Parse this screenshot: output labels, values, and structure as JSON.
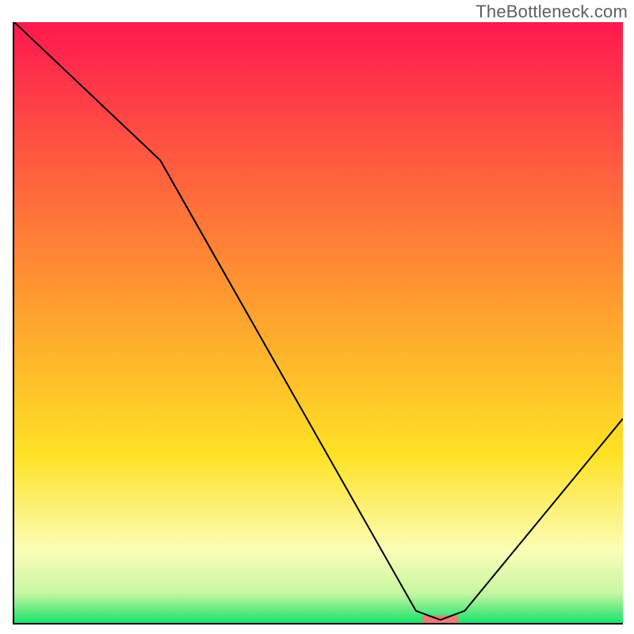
{
  "watermark": "TheBottleneck.com",
  "chart_data": {
    "type": "line",
    "title": "",
    "xlabel": "",
    "ylabel": "",
    "xlim": [
      0,
      100
    ],
    "ylim": [
      0,
      100
    ],
    "x": [
      0,
      24,
      66,
      70,
      74,
      100
    ],
    "values": [
      100,
      77,
      2,
      0.5,
      2,
      34
    ],
    "marker": {
      "x_range": [
        67,
        73
      ],
      "y": 0.5,
      "color": "#eb7c7b"
    },
    "gradient_stops": [
      {
        "pos": 0,
        "color": "#ff1950"
      },
      {
        "pos": 45,
        "color": "#ff9830"
      },
      {
        "pos": 72,
        "color": "#ffe225"
      },
      {
        "pos": 88,
        "color": "#fbfdb7"
      },
      {
        "pos": 95,
        "color": "#c8f7a2"
      },
      {
        "pos": 100,
        "color": "#19e36c"
      }
    ]
  }
}
